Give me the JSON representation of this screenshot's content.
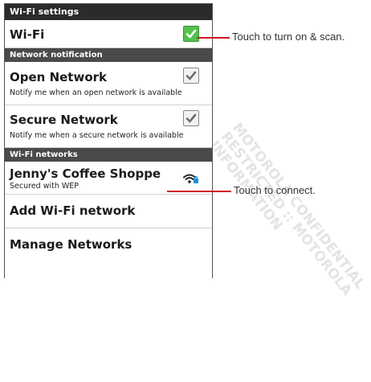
{
  "watermark": "MOTOROLA CONFIDENTIAL\nRESTRICTED :: MOTOROLA\nINFORMATION",
  "header": {
    "title": "Wi-Fi settings"
  },
  "wifi": {
    "label": "Wi-Fi",
    "checked": true
  },
  "sections": {
    "notification": "Network notification",
    "networks": "Wi-Fi networks"
  },
  "open_network": {
    "label": "Open Network",
    "summary": "Notify me when an open network is available",
    "checked": true
  },
  "secure_network": {
    "label": "Secure Network",
    "summary": "Notify me when a secure network is available",
    "checked": true
  },
  "network_item": {
    "name": "Jenny's Coffee Shoppe",
    "security": "Secured with WEP",
    "icon": "wifi-locked-icon"
  },
  "actions": {
    "add_network": "Add Wi-Fi network",
    "manage_networks": "Manage Networks"
  },
  "callouts": {
    "wifi_toggle": "Touch to turn on & scan.",
    "connect": "Touch to connect."
  },
  "colors": {
    "header_bg": "#2b2b2b",
    "section_bg": "#4a4a4a",
    "checkbox_green": "#52c34a",
    "callout_line": "#d0171f",
    "wifi_lock": "#1d8fd6"
  }
}
